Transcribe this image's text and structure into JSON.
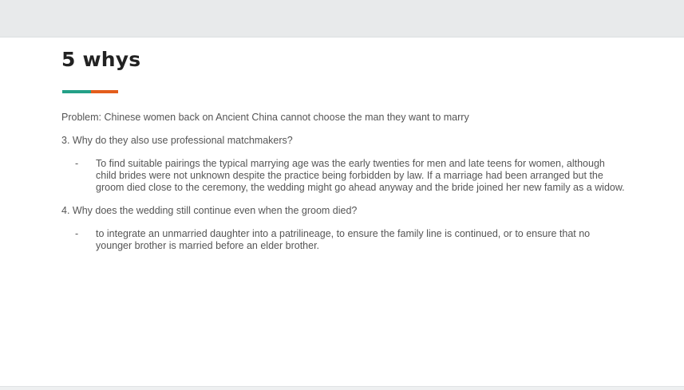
{
  "slide": {
    "title": "5 whys",
    "accent_colors": [
      "#23a087",
      "#e35d1c"
    ],
    "problem": "Problem: Chinese women back on Ancient China cannot choose the man they want to marry",
    "questions": [
      {
        "question": "3. Why do they also use professional matchmakers?",
        "bullet_marker": "-",
        "answer": "To find suitable pairings the typical marrying age was the early twenties for men and late teens for women, although child brides were not unknown despite the practice being forbidden by law. If a marriage had been arranged but the groom died close to the ceremony, the wedding might go ahead anyway and the bride joined her new family as a widow."
      },
      {
        "question": "4. Why does the wedding still continue even when the groom died?",
        "bullet_marker": "-",
        "answer": "to integrate an unmarried daughter into a patrilineage, to ensure the family line is continued, or to ensure that no younger brother is married before an elder brother."
      }
    ]
  }
}
